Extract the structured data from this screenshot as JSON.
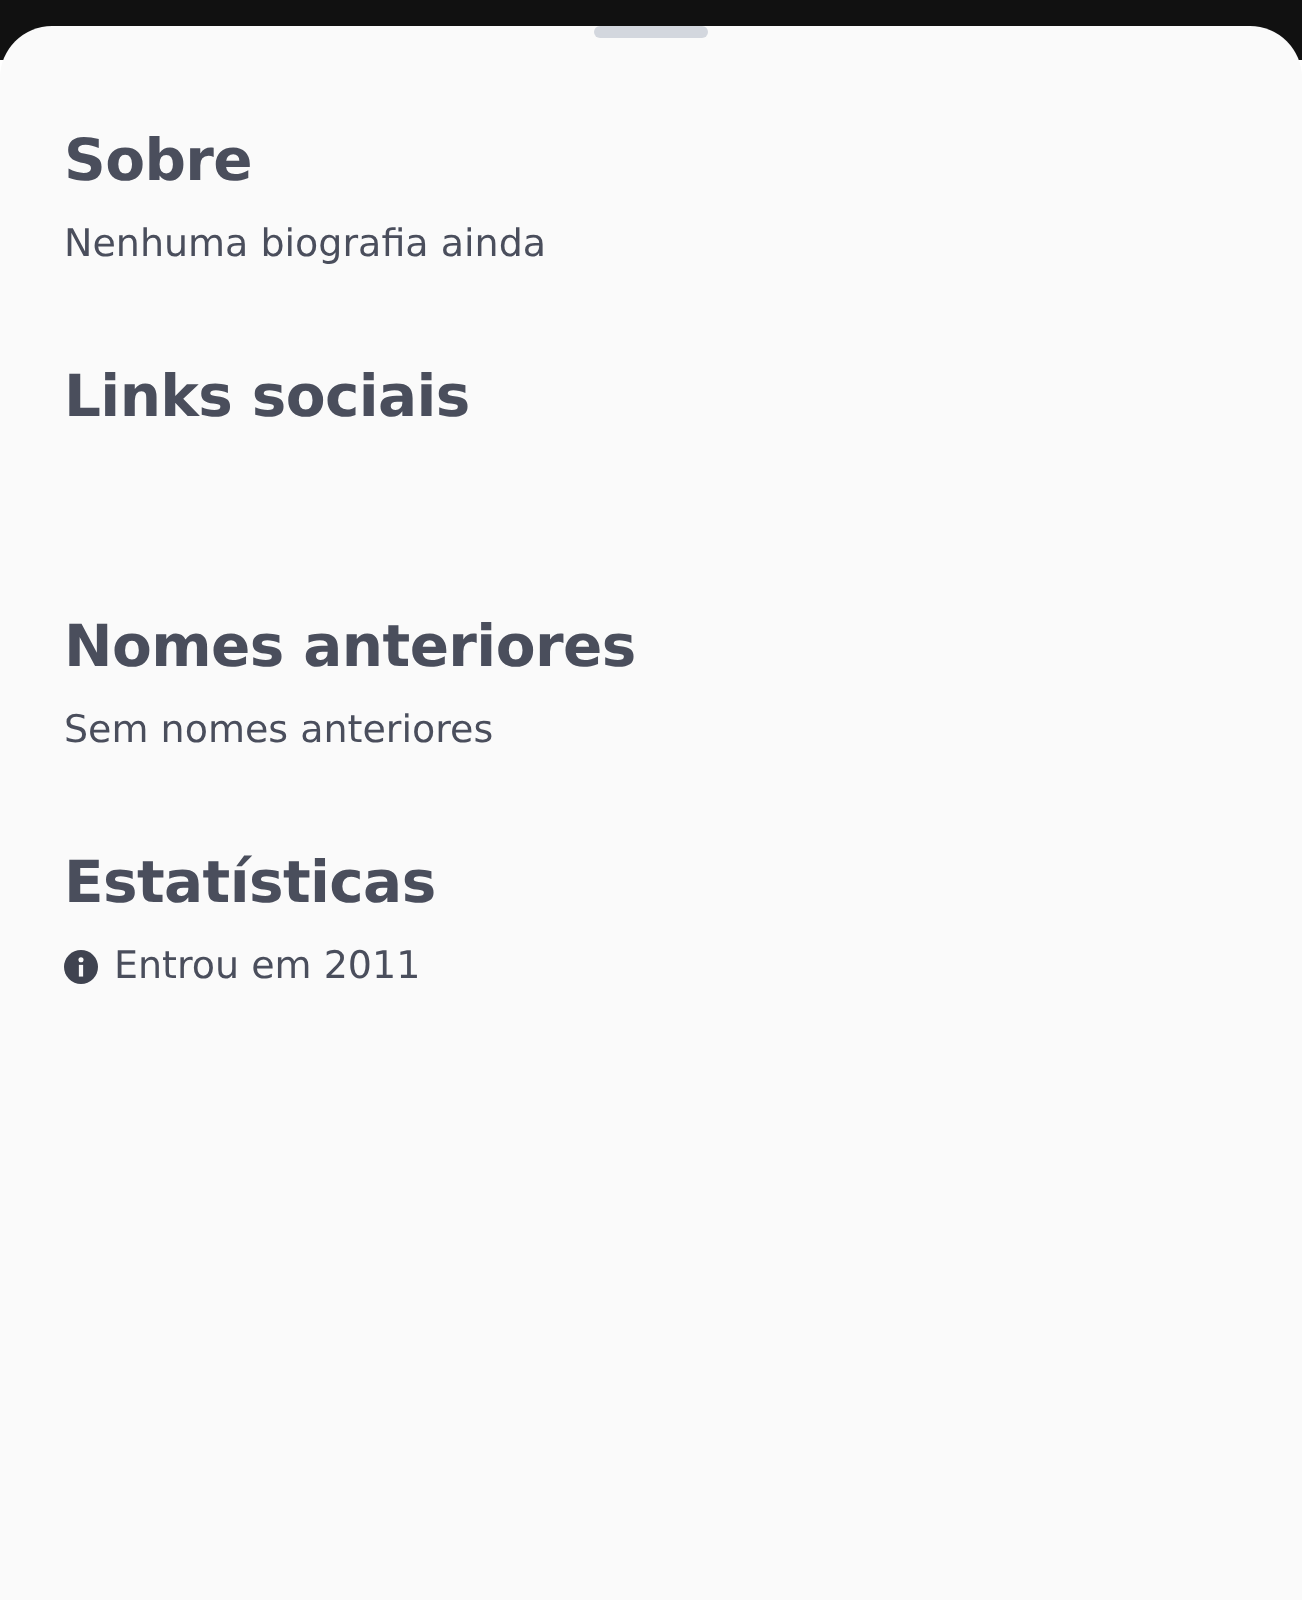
{
  "sections": [
    {
      "kind": "text",
      "title": "Sobre",
      "text": "Nenhuma biografia ainda"
    },
    {
      "kind": "links",
      "title": "Links sociais"
    },
    {
      "kind": "text",
      "title": "Nomes anteriores",
      "text": "Sem nomes anteriores"
    },
    {
      "kind": "stat",
      "title": "Estatísticas",
      "text": "Entrou em 2011"
    }
  ]
}
